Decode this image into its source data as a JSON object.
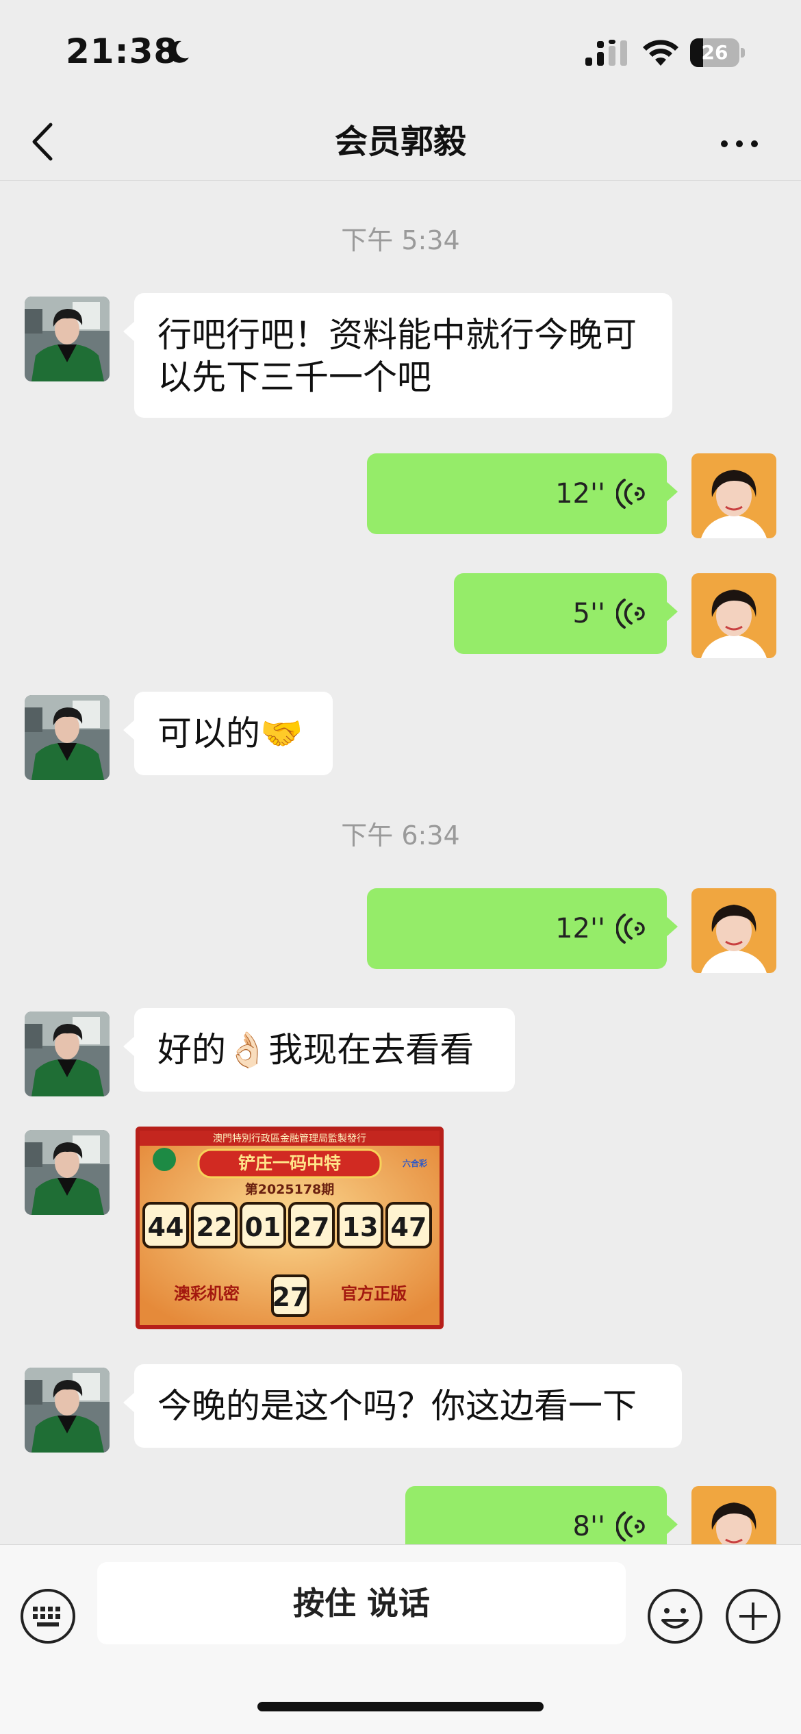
{
  "status_bar": {
    "time": "21:38",
    "battery": "26",
    "battery_level": 0.26
  },
  "nav": {
    "title": "会员郭毅"
  },
  "messages": {
    "ts1": "下午 5:34",
    "m1": "行吧行吧！资料能中就行今晚可以先下三千一个吧",
    "v1": "12''",
    "v2": "5''",
    "m2": "可以的🤝",
    "ts2": "下午 6:34",
    "v3": "12''",
    "m3": "好的👌🏻我现在去看看",
    "m4": "今晚的是这个吗？你这边看一下",
    "v4": "8''"
  },
  "lottery_image": {
    "header": "澳門特別行政區金融管理局監製發行",
    "title": "铲庄一码中特",
    "period": "第2025178期",
    "numbers": [
      "44",
      "22",
      "01",
      "27",
      "13",
      "47"
    ],
    "left_caption": "澳彩机密",
    "special": "27",
    "right_caption": "官方正版",
    "badge": "六合彩"
  },
  "input_bar": {
    "hold_to_talk": "按住 说话"
  },
  "colors": {
    "background": "#ededed",
    "sent_bubble": "#95ec69",
    "received_bubble": "#ffffff"
  }
}
